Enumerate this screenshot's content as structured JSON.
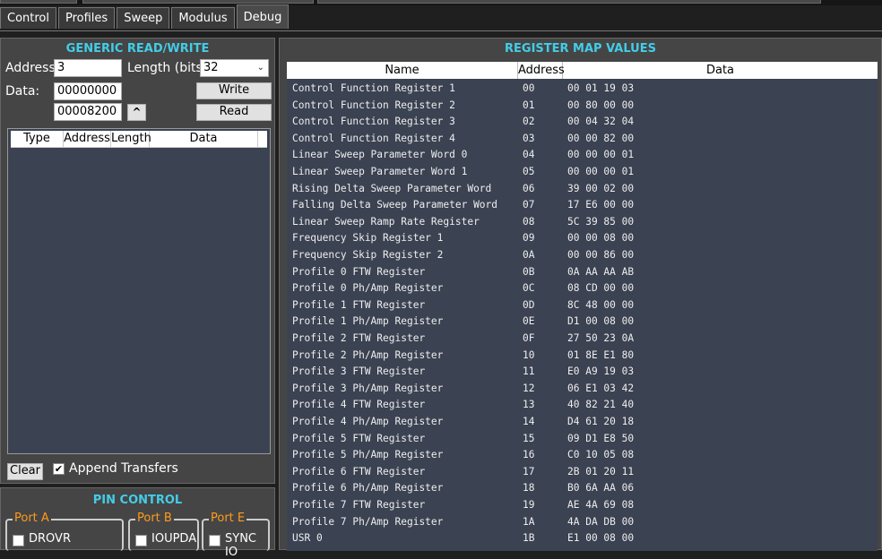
{
  "tabs": [
    "Control",
    "Profiles",
    "Sweep",
    "Modulus",
    "Debug"
  ],
  "generic": {
    "title": "GENERIC READ/WRITE",
    "address_label": "Address:",
    "address_value": "3",
    "length_label": "Length (bits):",
    "length_value": "32",
    "data_label": "Data:",
    "data_value": "00000000",
    "read_value": "00008200",
    "write_label": "Write",
    "read_label": "Read",
    "columns": [
      "Type",
      "Address",
      "Length",
      "Data"
    ],
    "clear_label": "Clear",
    "append_label": "Append Transfers",
    "append_checked": true
  },
  "pin": {
    "title": "PIN CONTROL",
    "groups": [
      {
        "label": "Port A",
        "item": "DROVR"
      },
      {
        "label": "Port B",
        "item": "IOUPDA"
      },
      {
        "label": "Port E",
        "item": "SYNC IO"
      }
    ]
  },
  "register": {
    "title": "REGISTER MAP VALUES",
    "columns": [
      "Name",
      "Address",
      "Data"
    ],
    "rows": [
      {
        "name": "Control Function Register 1",
        "address": "00",
        "data": "00 01 19 03"
      },
      {
        "name": "Control Function Register 2",
        "address": "01",
        "data": "00 80 00 00"
      },
      {
        "name": "Control Function Register 3",
        "address": "02",
        "data": "00 04 32 04"
      },
      {
        "name": "Control Function Register 4",
        "address": "03",
        "data": "00 00 82 00"
      },
      {
        "name": "Linear Sweep Parameter Word 0",
        "address": "04",
        "data": "00 00 00 01"
      },
      {
        "name": "Linear Sweep Parameter Word 1",
        "address": "05",
        "data": "00 00 00 01"
      },
      {
        "name": "Rising Delta Sweep Parameter Word",
        "address": "06",
        "data": "39 00 02 00"
      },
      {
        "name": "Falling Delta Sweep Parameter Word",
        "address": "07",
        "data": "17 E6 00 00"
      },
      {
        "name": "Linear Sweep Ramp Rate Register",
        "address": "08",
        "data": "5C 39 85 00"
      },
      {
        "name": "Frequency Skip Register 1",
        "address": "09",
        "data": "00 00 08 00"
      },
      {
        "name": "Frequency Skip Register 2",
        "address": "0A",
        "data": "00 00 86 00"
      },
      {
        "name": "Profile 0 FTW Register",
        "address": "0B",
        "data": "0A AA AA AB"
      },
      {
        "name": "Profile 0 Ph/Amp Register",
        "address": "0C",
        "data": "08 CD 00 00"
      },
      {
        "name": "Profile 1 FTW Register",
        "address": "0D",
        "data": "8C 48 00 00"
      },
      {
        "name": "Profile 1 Ph/Amp Register",
        "address": "0E",
        "data": "D1 00 08 00"
      },
      {
        "name": "Profile 2 FTW Register",
        "address": "0F",
        "data": "27 50 23 0A"
      },
      {
        "name": "Profile 2 Ph/Amp Register",
        "address": "10",
        "data": "01 8E E1 80"
      },
      {
        "name": "Profile 3 FTW Register",
        "address": "11",
        "data": "E0 A9 19 03"
      },
      {
        "name": "Profile 3 Ph/Amp Register",
        "address": "12",
        "data": "06 E1 03 42"
      },
      {
        "name": "Profile 4 FTW Register",
        "address": "13",
        "data": "40 82 21 40"
      },
      {
        "name": "Profile 4 Ph/Amp Register",
        "address": "14",
        "data": "D4 61 20 18"
      },
      {
        "name": "Profile 5 FTW Register",
        "address": "15",
        "data": "09 D1 E8 50"
      },
      {
        "name": "Profile 5 Ph/Amp Register",
        "address": "16",
        "data": "C0 10 05 08"
      },
      {
        "name": "Profile 6 FTW Register",
        "address": "17",
        "data": "2B 01 20 11"
      },
      {
        "name": "Profile 6 Ph/Amp Register",
        "address": "18",
        "data": "B0 6A AA 06"
      },
      {
        "name": "Profile 7 FTW Register",
        "address": "19",
        "data": "AE 4A 69 08"
      },
      {
        "name": "Profile 7 Ph/Amp Register",
        "address": "1A",
        "data": "4A DA DB 00"
      },
      {
        "name": "USR 0",
        "address": "1B",
        "data": "E1 00 08 00"
      }
    ]
  }
}
